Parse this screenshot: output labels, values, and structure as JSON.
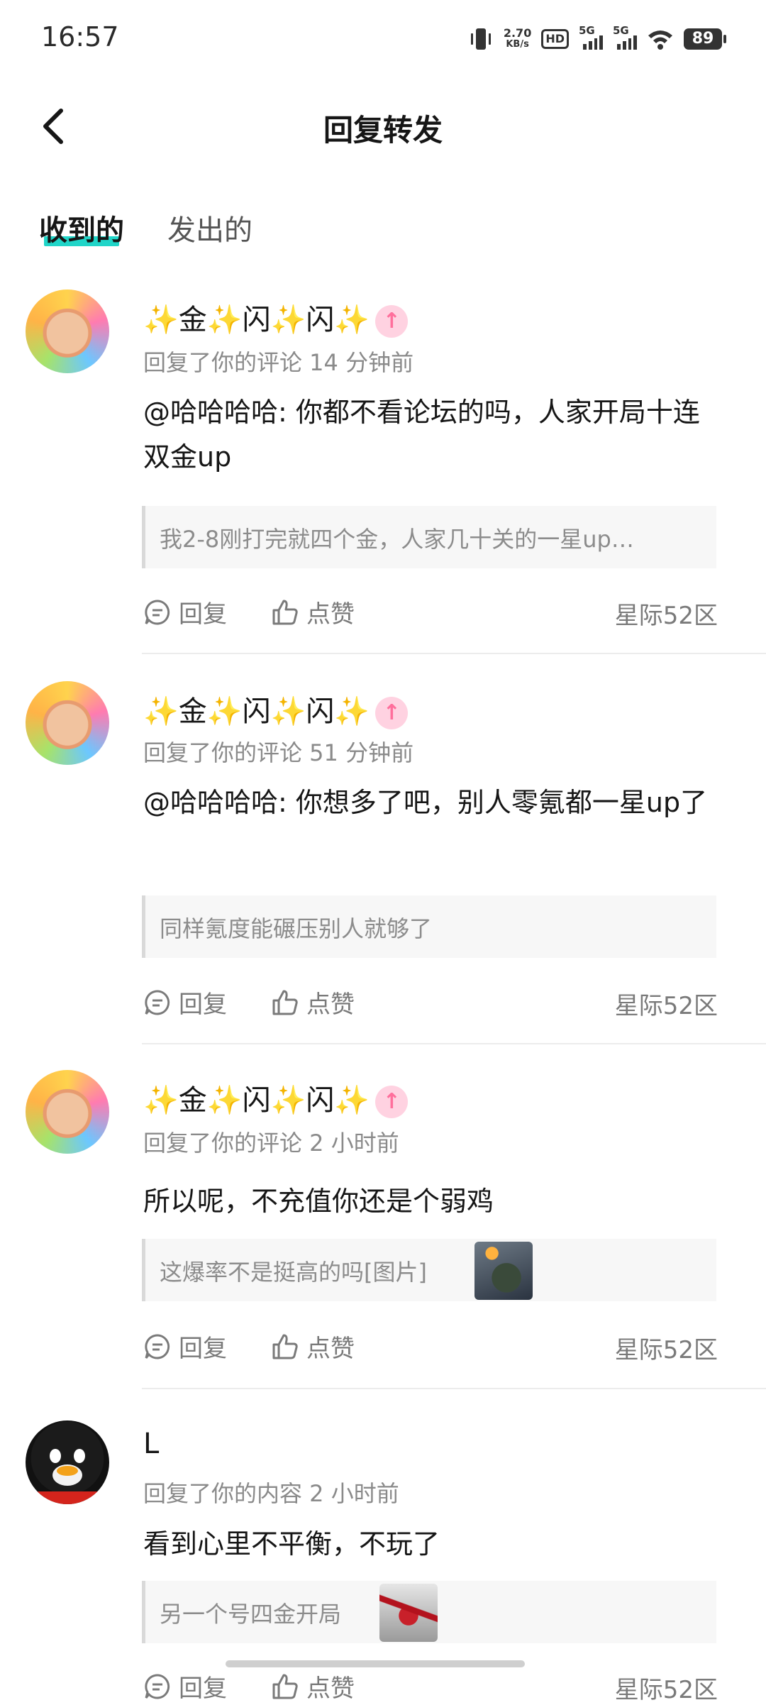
{
  "status_bar": {
    "time": "16:57",
    "net_speed_value": "2.70",
    "net_speed_unit": "KB/s",
    "hd_label": "HD",
    "signal1_label": "5G",
    "signal2_label": "5G",
    "battery": "89"
  },
  "header": {
    "title": "回复转发"
  },
  "tabs": [
    {
      "label": "收到的",
      "active": true
    },
    {
      "label": "发出的",
      "active": false
    }
  ],
  "notifications": [
    {
      "username": "✨金✨闪✨闪✨",
      "meta": "回复了你的评论 14 分钟前",
      "content": "@哈哈哈哈: 你都不看论坛的吗，人家开局十连双金up",
      "quote": "我2-8刚打完就四个金，人家几十关的一星up…",
      "reply_label": "回复",
      "like_label": "点赞",
      "region": "星际52区"
    },
    {
      "username": "✨金✨闪✨闪✨",
      "meta": "回复了你的评论 51 分钟前",
      "content": "@哈哈哈哈: 你想多了吧，别人零氪都一星up了",
      "quote": "同样氪度能碾压别人就够了",
      "reply_label": "回复",
      "like_label": "点赞",
      "region": "星际52区"
    },
    {
      "username": "✨金✨闪✨闪✨",
      "meta": "回复了你的评论 2 小时前",
      "content": "所以呢，不充值你还是个弱鸡",
      "quote": "这爆率不是挺高的吗[图片]",
      "reply_label": "回复",
      "like_label": "点赞",
      "region": "星际52区"
    },
    {
      "username": "L",
      "meta": "回复了你的内容 2 小时前",
      "content": "看到心里不平衡，不玩了",
      "quote": "另一个号四金开局",
      "reply_label": "回复",
      "like_label": "点赞",
      "region": "星际52区"
    }
  ]
}
